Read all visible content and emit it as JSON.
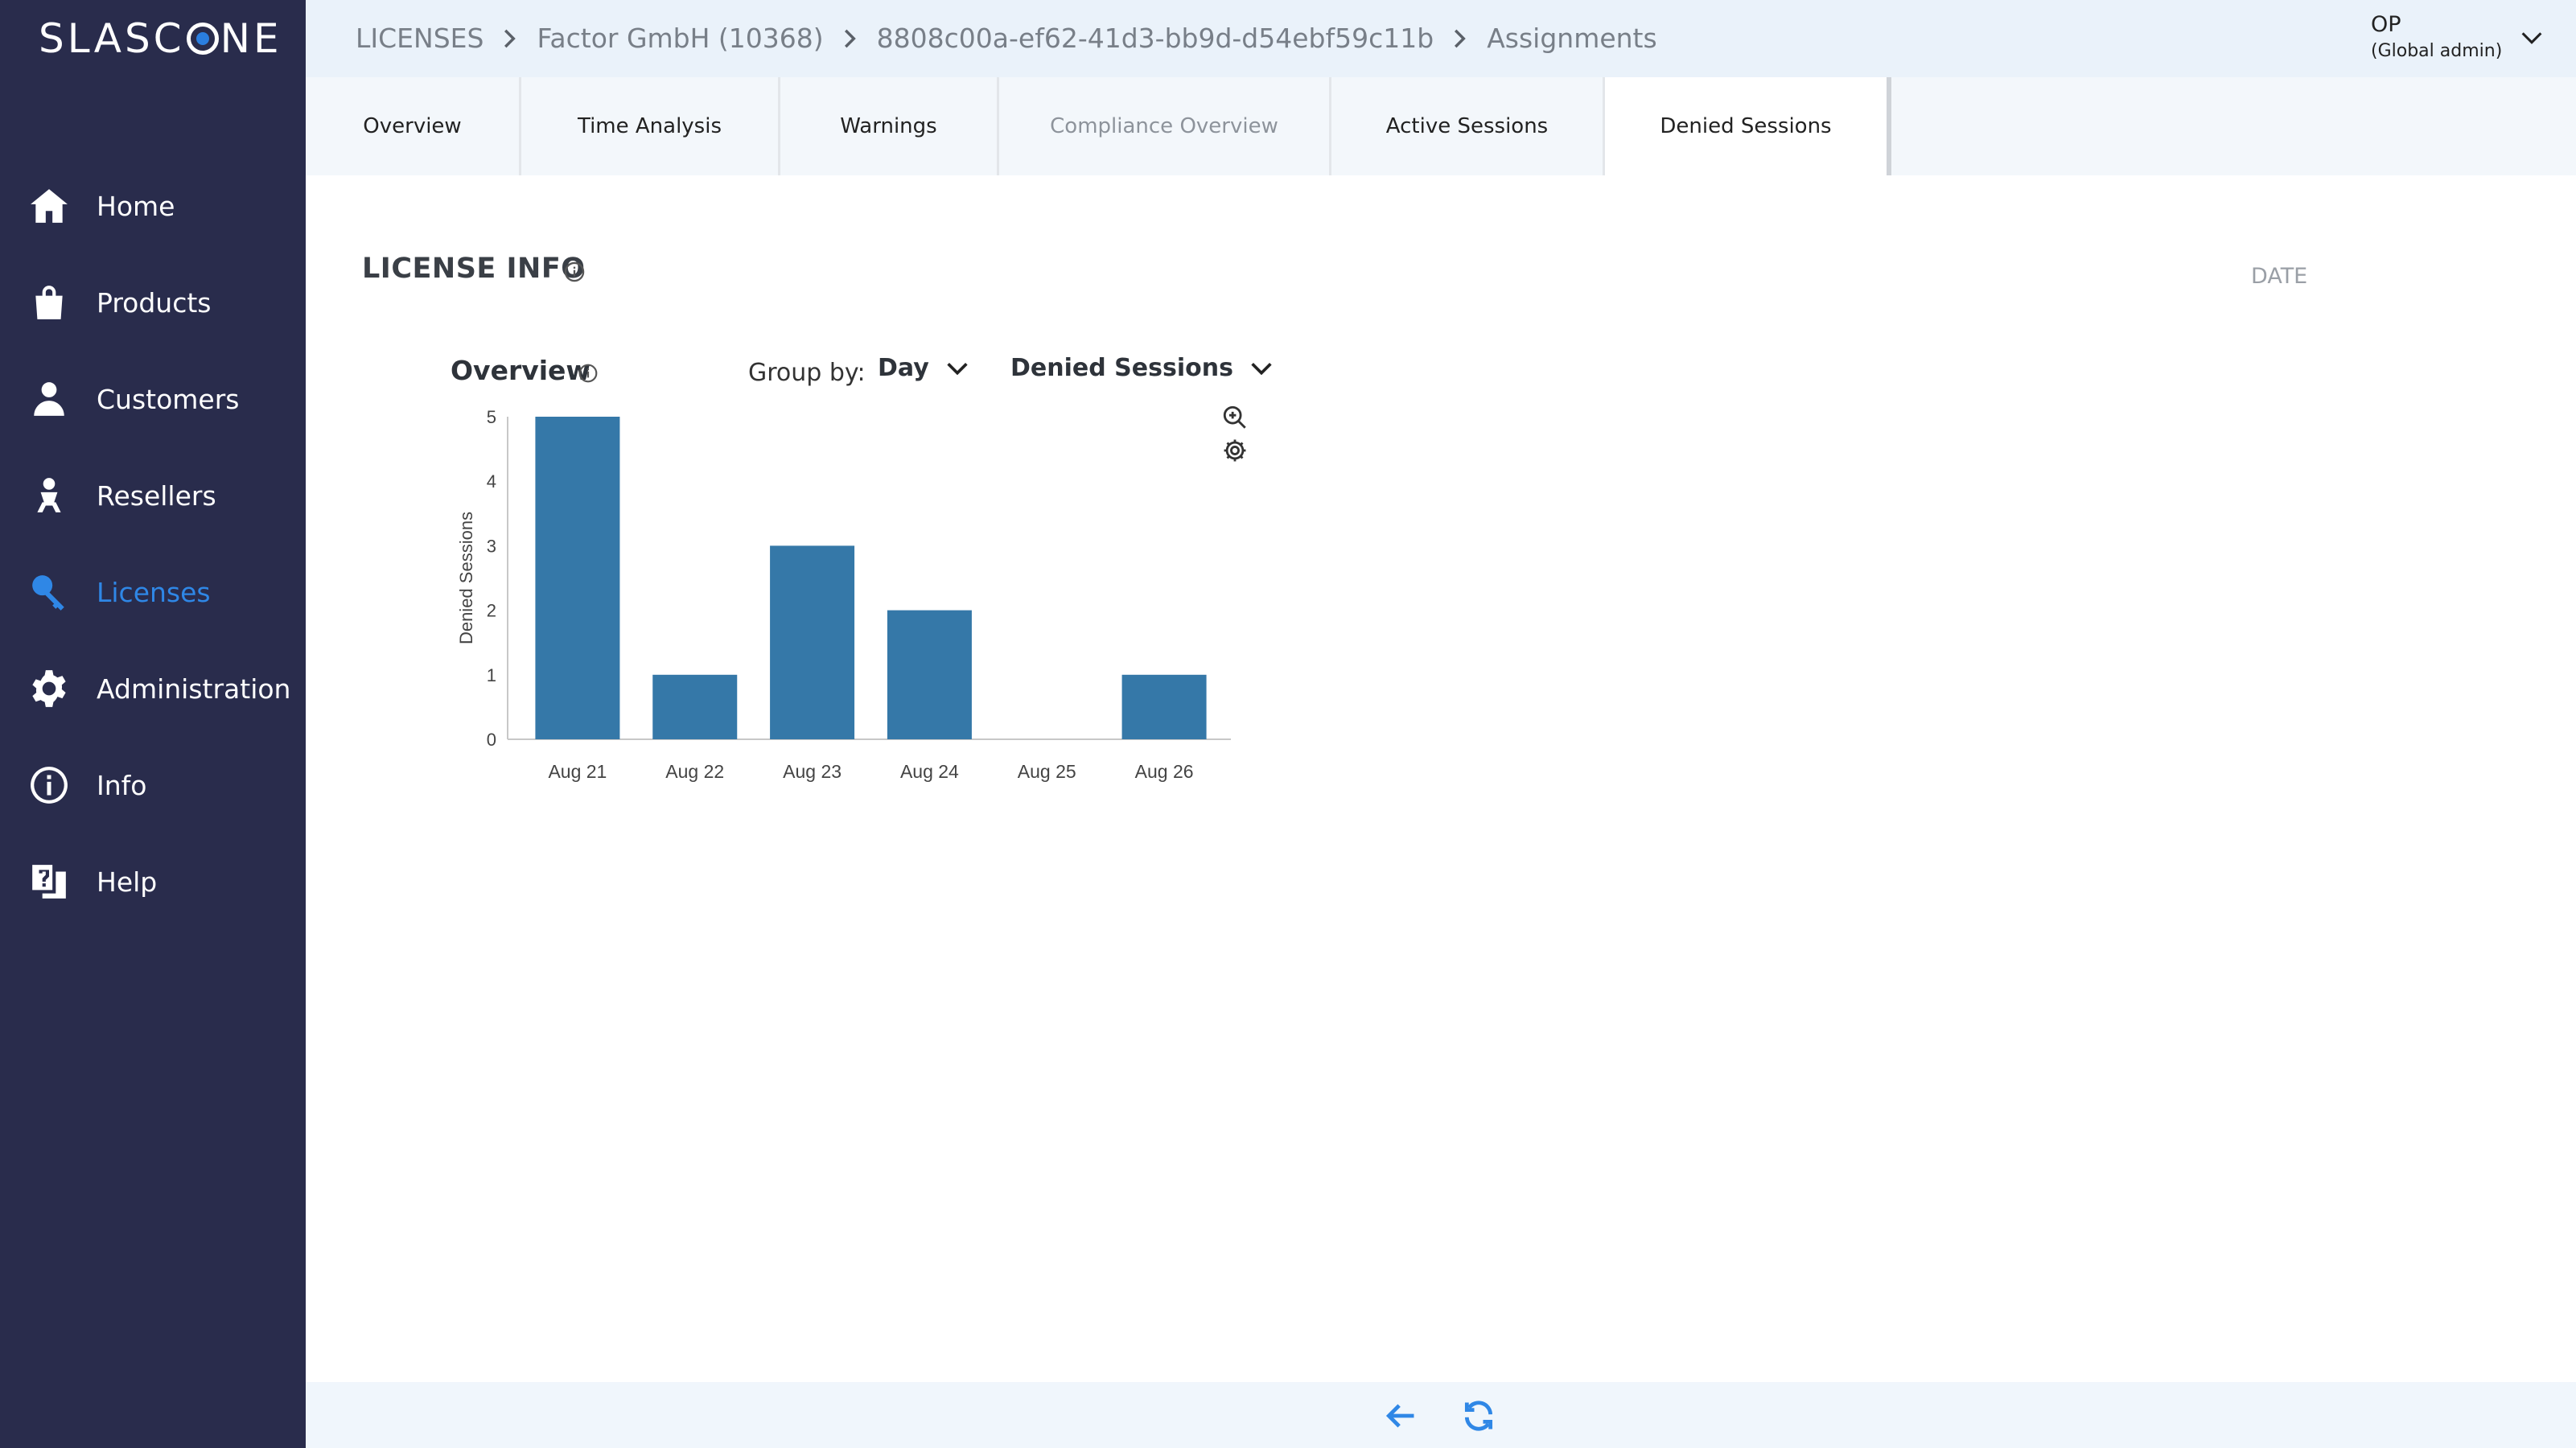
{
  "app": {
    "logo_text_left": "SLASC",
    "logo_text_right": "NE"
  },
  "sidebar": {
    "items": [
      {
        "label": "Home",
        "icon": "home-icon"
      },
      {
        "label": "Products",
        "icon": "shopping-bag-icon"
      },
      {
        "label": "Customers",
        "icon": "customer-icon"
      },
      {
        "label": "Resellers",
        "icon": "reseller-icon"
      },
      {
        "label": "Licenses",
        "icon": "key-icon",
        "active": true
      },
      {
        "label": "Administration",
        "icon": "gear-icon"
      },
      {
        "label": "Info",
        "icon": "info-icon"
      },
      {
        "label": "Help",
        "icon": "help-icon"
      }
    ]
  },
  "breadcrumb": {
    "items": [
      "LICENSES",
      "Factor GmbH (10368)",
      "8808c00a-ef62-41d3-bb9d-d54ebf59c11b",
      "Assignments"
    ]
  },
  "user": {
    "name": "OP",
    "role": "(Global admin)"
  },
  "tabs": [
    {
      "label": "Overview"
    },
    {
      "label": "Time Analysis"
    },
    {
      "label": "Warnings"
    },
    {
      "label": "Compliance Overview",
      "disabled": true
    },
    {
      "label": "Active Sessions"
    },
    {
      "label": "Denied Sessions",
      "active": true
    }
  ],
  "main": {
    "section_title": "LICENSE INFO",
    "date_label": "DATE",
    "overview_title": "Overview",
    "group_by_label": "Group by:",
    "group_by_value": "Day",
    "metric_value": "Denied Sessions"
  },
  "colors": {
    "sidebar_bg": "#292c4c",
    "accent": "#2f87e6",
    "bar": "#3578a8"
  },
  "chart_data": {
    "type": "bar",
    "categories": [
      "Aug 21",
      "Aug 22",
      "Aug 23",
      "Aug 24",
      "Aug 25",
      "Aug 26"
    ],
    "values": [
      5,
      1,
      3,
      2,
      0,
      1
    ],
    "title": "",
    "xlabel": "",
    "ylabel": "Denied Sessions",
    "ylim": [
      0,
      5
    ],
    "yticks": [
      0,
      1,
      2,
      3,
      4,
      5
    ],
    "grid": false
  }
}
